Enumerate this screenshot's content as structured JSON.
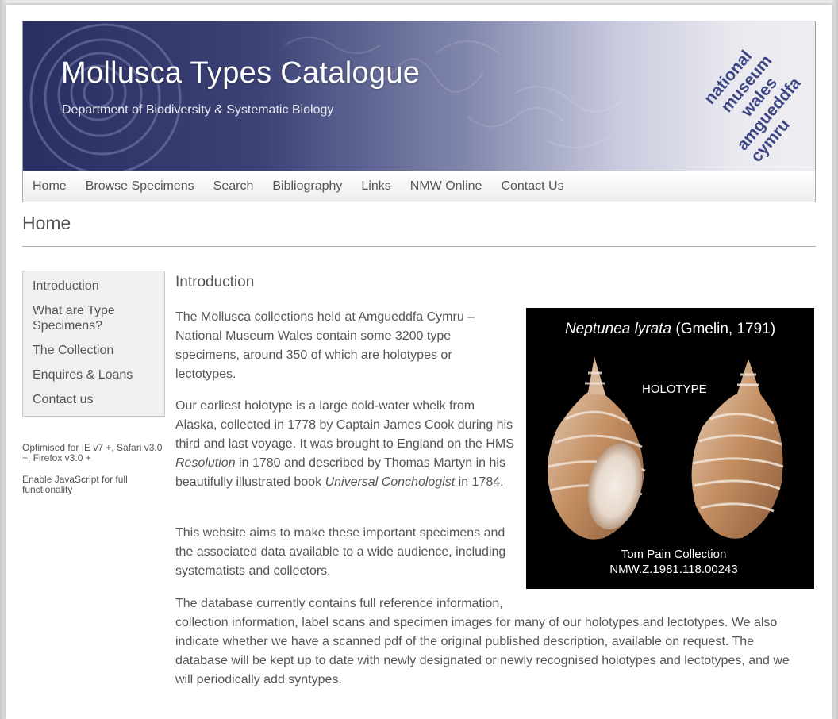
{
  "banner": {
    "title": "Mollusca Types Catalogue",
    "subtitle": "Department of Biodiversity & Systematic Biology",
    "logo_lines": [
      "national",
      "museum",
      "wales",
      "amgueddfa",
      "cymru"
    ]
  },
  "nav": {
    "items": [
      "Home",
      "Browse Specimens",
      "Search",
      "Bibliography",
      "Links",
      "NMW Online",
      "Contact Us"
    ]
  },
  "page": {
    "title": "Home"
  },
  "sidebar": {
    "items": [
      "Introduction",
      "What are Type Specimens?",
      "The Collection",
      "Enquires & Loans",
      "Contact us"
    ],
    "note_browsers": "Optimised for IE v7 +, Safari v3.0 +, Firefox v3.0 +",
    "note_js": "Enable JavaScript for full functionality"
  },
  "main": {
    "heading": "Introduction",
    "p1": "The Mollusca collections held at Amgueddfa Cymru – National Museum Wales contain some 3200 type specimens, around 350 of which are holotypes or lectotypes.",
    "p2_a": "Our earliest holotype is a large cold-water whelk from Alaska, collected in 1778 by Captain James Cook during his third and last voyage. It was brought to England on the HMS ",
    "p2_ship": "Resolution",
    "p2_b": " in 1780 and described by Thomas Martyn in his beautifully illustrated book ",
    "p2_book": "Universal Conchologist",
    "p2_c": " in 1784.",
    "p3": "This website aims to make these important specimens and the associated data available to a wide audience, including systematists and collectors.",
    "p4_line1": "The database currently contains full reference information,",
    "p4_rest": "collection information, label scans and specimen images for many of our holotypes and lectotypes. We also indicate whether we have a scanned pdf of the original published description, available on request. The database will be kept up to date with newly designated or newly recognised holotypes and lectotypes, and we will periodically add syntypes."
  },
  "specimen": {
    "genus_species": "Neptunea lyrata",
    "author": " (Gmelin, 1791)",
    "status": "HOLOTYPE",
    "collection": "Tom Pain Collection",
    "number": "NMW.Z.1981.118.00243"
  },
  "colors": {
    "banner_dark": "#2a2f63",
    "logo": "#3e4684",
    "text": "#555555",
    "sidebar_bg": "#f0f0f0"
  }
}
